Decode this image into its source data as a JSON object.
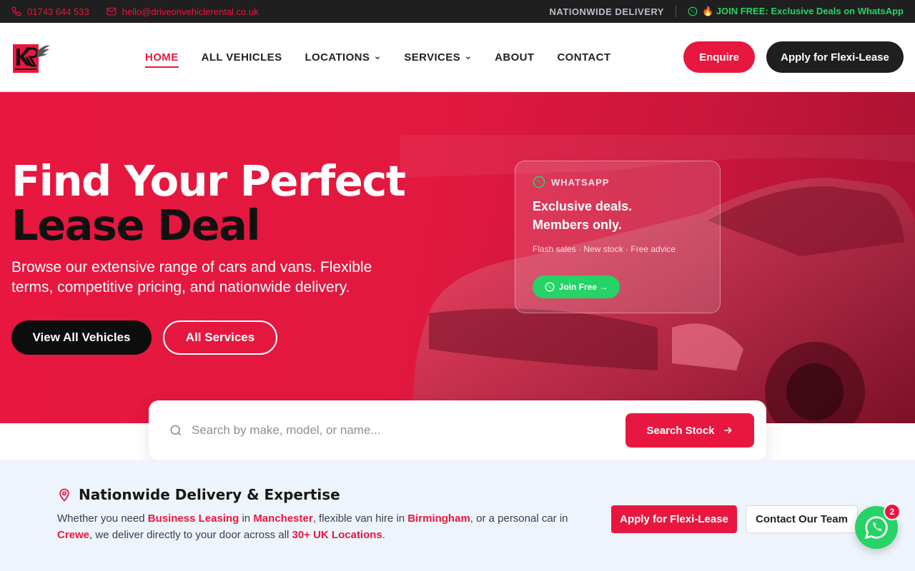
{
  "topbar": {
    "phone": "01743 644 533",
    "email": "hello@driveonvehiclerental.co.uk",
    "delivery": "NATIONWIDE DELIVERY",
    "whatsapp_deal": "🔥 JOIN FREE: Exclusive Deals on WhatsApp"
  },
  "nav": {
    "items": [
      {
        "label": "HOME"
      },
      {
        "label": "ALL VEHICLES"
      },
      {
        "label": "LOCATIONS"
      },
      {
        "label": "SERVICES"
      },
      {
        "label": "ABOUT"
      },
      {
        "label": "CONTACT"
      }
    ],
    "enquire": "Enquire",
    "flexi_lease": "Apply for Flexi-Lease"
  },
  "hero": {
    "title_line1": "Find Your Perfect",
    "title_line2": "Lease Deal",
    "subtitle": "Browse our extensive range of cars and vans. Flexible terms, competitive pricing, and nationwide delivery.",
    "view_all": "View All Vehicles",
    "all_services": "All Services"
  },
  "whatsapp_card": {
    "tag": "WHATSAPP",
    "headline_line1": "Exclusive deals.",
    "headline_line2": "Members only.",
    "meta": "Flash sales · New stock · Free advice",
    "join": "Join Free →"
  },
  "search": {
    "placeholder": "Search by make, model, or name...",
    "button": "Search Stock"
  },
  "delivery_section": {
    "title": "Nationwide Delivery & Expertise",
    "desc_1": "Whether you need ",
    "link_business": "Business Leasing",
    "desc_2": " in ",
    "link_manchester": "Manchester",
    "desc_3": ", flexible van hire in ",
    "link_birmingham": "Birmingham",
    "desc_4": ", or a personal car in ",
    "link_crewe": "Crewe",
    "desc_5": ", we deliver directly to your door across all ",
    "link_locations": "30+ UK Locations",
    "desc_6": ".",
    "apply": "Apply for Flexi-Lease",
    "contact": "Contact Our Team"
  },
  "whatsapp_float": {
    "badge": "2"
  },
  "colors": {
    "brand_red": "#e8173f",
    "dark": "#1f1f1f",
    "whatsapp_green": "#25d366",
    "strip_bg": "#eef4fb"
  }
}
